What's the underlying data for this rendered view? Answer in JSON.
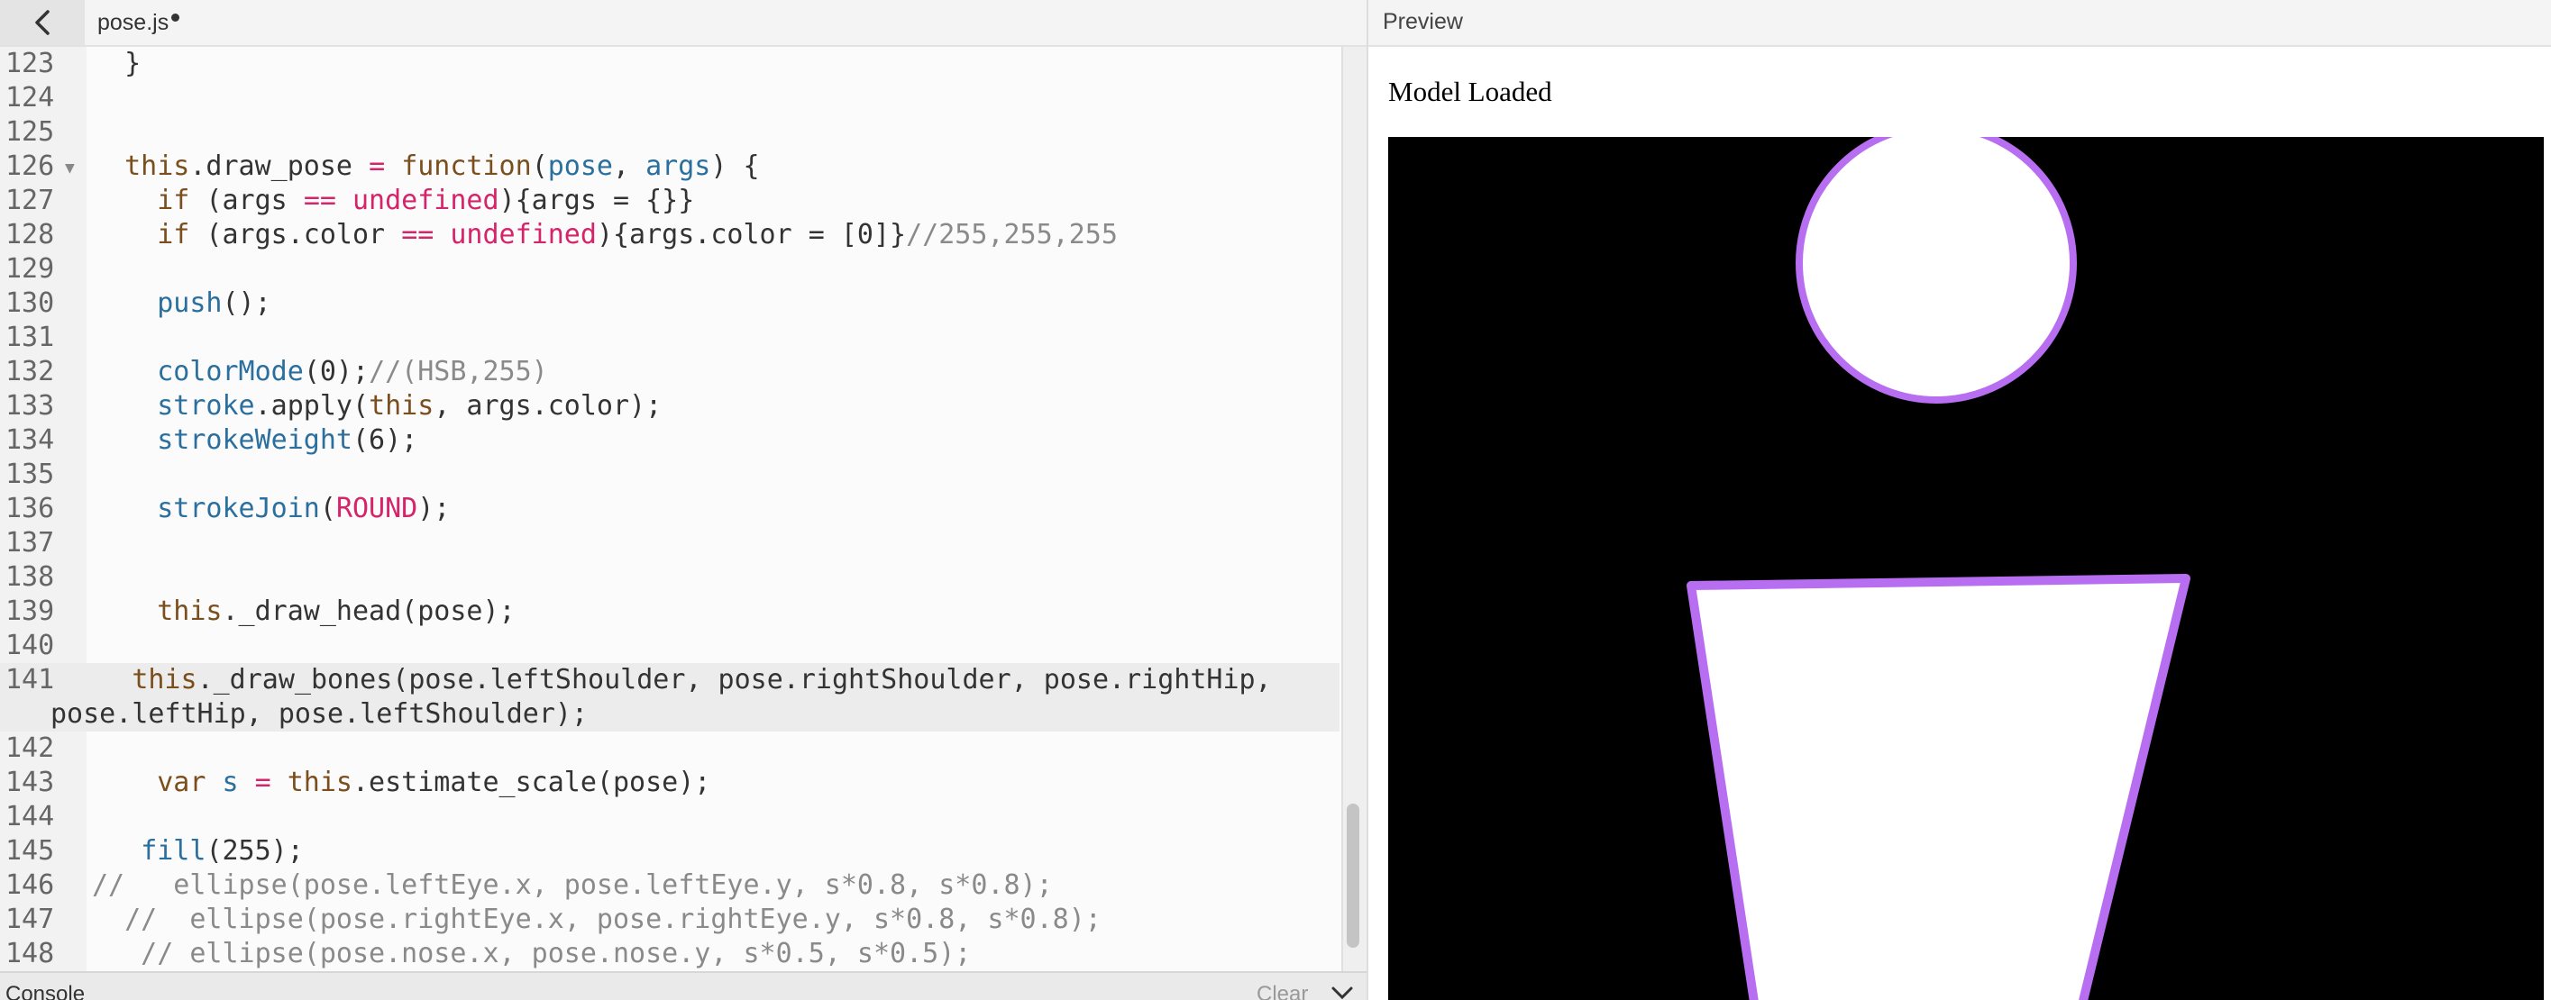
{
  "editor": {
    "file_name": "pose.js",
    "unsaved": true,
    "lines": [
      {
        "n": "123",
        "tokens": [
          [
            "pl",
            "  }"
          ]
        ]
      },
      {
        "n": "124",
        "tokens": []
      },
      {
        "n": "125",
        "tokens": []
      },
      {
        "n": "126",
        "fold": true,
        "tokens": [
          [
            "pl",
            "  "
          ],
          [
            "kw",
            "this"
          ],
          [
            "pl",
            ".draw_pose "
          ],
          [
            "op",
            "="
          ],
          [
            "pl",
            " "
          ],
          [
            "kw",
            "function"
          ],
          [
            "pl",
            "("
          ],
          [
            "id",
            "pose"
          ],
          [
            "pl",
            ", "
          ],
          [
            "id",
            "args"
          ],
          [
            "pl",
            ") {"
          ]
        ]
      },
      {
        "n": "127",
        "tokens": [
          [
            "pl",
            "    "
          ],
          [
            "kw",
            "if"
          ],
          [
            "pl",
            " (args "
          ],
          [
            "op",
            "=="
          ],
          [
            "pl",
            " "
          ],
          [
            "ct",
            "undefined"
          ],
          [
            "pl",
            "){args = {}}"
          ]
        ]
      },
      {
        "n": "128",
        "tokens": [
          [
            "pl",
            "    "
          ],
          [
            "kw",
            "if"
          ],
          [
            "pl",
            " (args.color "
          ],
          [
            "op",
            "=="
          ],
          [
            "pl",
            " "
          ],
          [
            "ct",
            "undefined"
          ],
          [
            "pl",
            "){args.color = [0]}"
          ],
          [
            "cm",
            "//255,255,255"
          ]
        ]
      },
      {
        "n": "129",
        "tokens": []
      },
      {
        "n": "130",
        "tokens": [
          [
            "pl",
            "    "
          ],
          [
            "fn",
            "push"
          ],
          [
            "pl",
            "();"
          ]
        ]
      },
      {
        "n": "131",
        "tokens": []
      },
      {
        "n": "132",
        "tokens": [
          [
            "pl",
            "    "
          ],
          [
            "fn",
            "colorMode"
          ],
          [
            "pl",
            "(0);"
          ],
          [
            "cm",
            "//(HSB,255)"
          ]
        ]
      },
      {
        "n": "133",
        "tokens": [
          [
            "pl",
            "    "
          ],
          [
            "fn",
            "stroke"
          ],
          [
            "pl",
            ".apply("
          ],
          [
            "kw",
            "this"
          ],
          [
            "pl",
            ", args.color);"
          ]
        ]
      },
      {
        "n": "134",
        "tokens": [
          [
            "pl",
            "    "
          ],
          [
            "fn",
            "strokeWeight"
          ],
          [
            "pl",
            "(6);"
          ]
        ]
      },
      {
        "n": "135",
        "tokens": []
      },
      {
        "n": "136",
        "tokens": [
          [
            "pl",
            "    "
          ],
          [
            "fn",
            "strokeJoin"
          ],
          [
            "pl",
            "("
          ],
          [
            "ct",
            "ROUND"
          ],
          [
            "pl",
            ");"
          ]
        ]
      },
      {
        "n": "137",
        "tokens": []
      },
      {
        "n": "138",
        "tokens": []
      },
      {
        "n": "139",
        "tokens": [
          [
            "pl",
            "    "
          ],
          [
            "kw",
            "this"
          ],
          [
            "pl",
            "._draw_head(pose);"
          ]
        ]
      },
      {
        "n": "140",
        "tokens": []
      },
      {
        "n": "141",
        "active": true,
        "wrapped": true,
        "tokens": [
          [
            "pl",
            "     "
          ],
          [
            "kw",
            "this"
          ],
          [
            "pl",
            "._draw_bones(pose.leftShoulder, pose.rightShoulder, pose.rightHip,\npose.leftHip, pose.leftShoulder);"
          ]
        ]
      },
      {
        "n": "142",
        "tokens": []
      },
      {
        "n": "143",
        "tokens": [
          [
            "pl",
            "    "
          ],
          [
            "kw",
            "var"
          ],
          [
            "pl",
            " "
          ],
          [
            "id",
            "s"
          ],
          [
            "pl",
            " "
          ],
          [
            "op",
            "="
          ],
          [
            "pl",
            " "
          ],
          [
            "kw",
            "this"
          ],
          [
            "pl",
            ".estimate_scale(pose);"
          ]
        ]
      },
      {
        "n": "144",
        "tokens": []
      },
      {
        "n": "145",
        "tokens": [
          [
            "pl",
            "   "
          ],
          [
            "fn",
            "fill"
          ],
          [
            "pl",
            "(255);"
          ]
        ]
      },
      {
        "n": "146",
        "tokens": [
          [
            "cm",
            "//   ellipse(pose.leftEye.x, pose.leftEye.y, s*0.8, s*0.8);"
          ]
        ]
      },
      {
        "n": "147",
        "tokens": [
          [
            "cm",
            "  //  ellipse(pose.rightEye.x, pose.rightEye.y, s*0.8, s*0.8);"
          ]
        ]
      },
      {
        "n": "148",
        "tokens": [
          [
            "cm",
            "   // ellipse(pose.nose.x, pose.nose.y, s*0.5, s*0.5);"
          ]
        ]
      }
    ]
  },
  "console": {
    "label": "Console",
    "clear_label": "Clear"
  },
  "preview": {
    "title": "Preview",
    "status": "Model Loaded",
    "figure_stroke_color": "#b86ef0",
    "canvas_bg": "#000000",
    "figure_fill": "#ffffff"
  },
  "icons": {
    "back": "chevron-left-icon",
    "collapse": "chevron-down-icon",
    "fold": "fold-triangle-icon"
  }
}
